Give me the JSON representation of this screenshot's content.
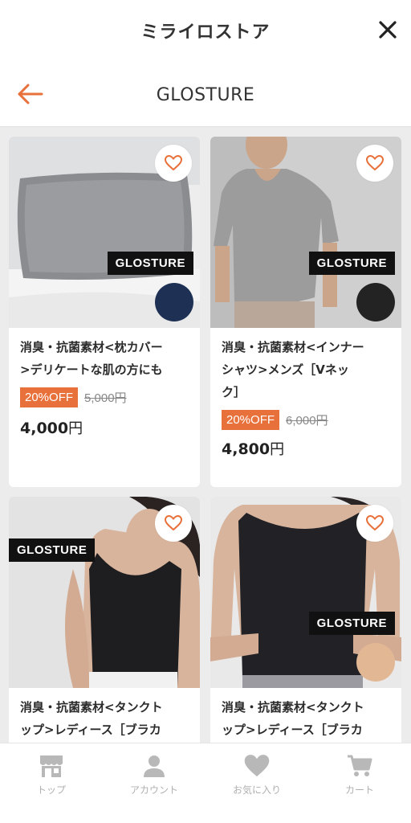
{
  "header": {
    "store_title": "ミライロストア",
    "close_icon": "close-icon"
  },
  "subheader": {
    "back_icon": "back-arrow-icon",
    "brand_title": "GLOSTURE",
    "accent_color": "#e8703a"
  },
  "products": [
    {
      "name_lines": [
        "消臭・抗菌素材<枕カバー",
        ">デリケートな肌の方にも"
      ],
      "badge": "GLOSTURE",
      "discount": "20%OFF",
      "old_price": "5,000円",
      "price": "4,000",
      "currency": "円",
      "swatch_color": "#1e3154"
    },
    {
      "name_lines": [
        "消臭・抗菌素材<インナー",
        "シャツ>メンズ［Vネッ",
        "ク］"
      ],
      "badge": "GLOSTURE",
      "discount": "20%OFF",
      "old_price": "6,000円",
      "price": "4,800",
      "currency": "円",
      "swatch_color": "#232323"
    },
    {
      "name_lines": [
        "消臭・抗菌素材<タンクト",
        "ップ>レディース［ブラカ"
      ],
      "badge": "GLOSTURE"
    },
    {
      "name_lines": [
        "消臭・抗菌素材<タンクト",
        "ップ>レディース［ブラカ"
      ],
      "badge": "GLOSTURE",
      "swatch_color": "#e2b894"
    }
  ],
  "bottom_nav": [
    {
      "label": "トップ",
      "icon": "store-icon"
    },
    {
      "label": "アカウント",
      "icon": "person-icon"
    },
    {
      "label": "お気に入り",
      "icon": "heart-icon"
    },
    {
      "label": "カート",
      "icon": "cart-icon"
    }
  ]
}
